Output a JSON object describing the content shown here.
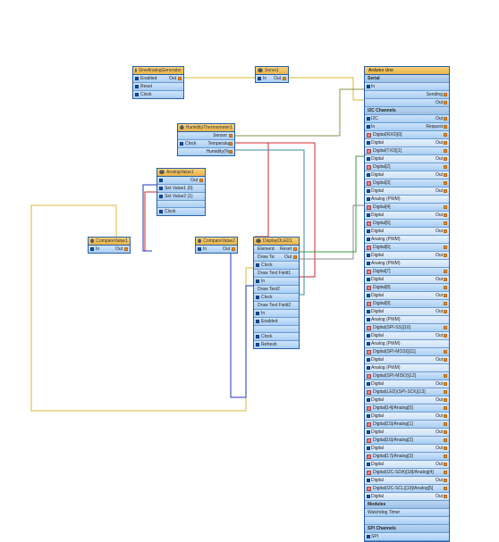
{
  "nodes": {
    "sineGen": {
      "title": "SineAnalogGenerator",
      "rows": [
        {
          "in": "Enabled",
          "out": "Out"
        },
        {
          "in": "Reset",
          "out": ""
        },
        {
          "in": "Clock",
          "out": ""
        }
      ]
    },
    "servo": {
      "title": "Servo1",
      "rows": [
        {
          "in": "In",
          "out": "Out"
        }
      ]
    },
    "thermo": {
      "title": "HumidityThermometer1",
      "rows": [
        {
          "in": "",
          "out": "Sensor"
        },
        {
          "in": "Clock",
          "out": "Temperature"
        },
        {
          "in": "",
          "out": "Humidity(%)"
        }
      ]
    },
    "analogVal": {
      "title": "AnalogValue1",
      "rows": [
        {
          "in": "",
          "out": "Out"
        },
        {
          "in": "Set Value1 (0)",
          "out": ""
        },
        {
          "in": "Set Value2 (1)",
          "out": ""
        },
        {
          "in": "",
          "out": ""
        },
        {
          "in": "Clock",
          "out": ""
        }
      ]
    },
    "compare1": {
      "title": "CompareValue1",
      "rows": [
        {
          "in": "In",
          "out": "Out"
        }
      ]
    },
    "compare2": {
      "title": "CompareValue2",
      "rows": [
        {
          "in": "In",
          "out": "Out"
        }
      ]
    },
    "display": {
      "title": "DisplayOLED1",
      "rows": [
        {
          "in": "Elements",
          "out": "Reset"
        },
        {
          "in": "Draw Text1",
          "out": "Out"
        },
        {
          "in": "Clock",
          "out": ""
        },
        {
          "in": "Draw Text Field1",
          "out": ""
        },
        {
          "in": "In",
          "out": ""
        },
        {
          "in": "Draw Text2",
          "out": ""
        },
        {
          "in": "Clock",
          "out": ""
        },
        {
          "in": "Draw Text Field2",
          "out": ""
        },
        {
          "in": "In",
          "out": ""
        },
        {
          "in": "Enabled",
          "out": ""
        },
        {
          "in": "",
          "out": ""
        },
        {
          "in": "Clock",
          "out": ""
        },
        {
          "in": "Refresh",
          "out": ""
        }
      ]
    }
  },
  "arduino": {
    "title": "Arduino Uno",
    "serial": {
      "label": "Serial",
      "items": [
        "In",
        "",
        "Sending",
        "Out"
      ]
    },
    "i2c": {
      "label": "I2C Channels",
      "items": [
        "I2C",
        "In",
        "Out",
        "Request"
      ]
    },
    "digital_label": "Digital",
    "out_label": "Out",
    "channels": [
      "Digital(RX0)[0]",
      "Digital(TX0)[1]",
      "Digital[2]",
      "Digital[3]",
      "Digital[4]",
      "Digital[5]",
      "Digital[6]",
      "Digital[7]",
      "Digital[8]",
      "Digital[9]",
      "Digital(SPI-SS)[10]",
      "Digital(SPI-MOSI)[11]",
      "Digital(SPI-MISO)[12]",
      "Digital(LED)(SPI-SCK)[13]",
      "Digital[14]/Analog[0]",
      "Digital[15]/Analog[1]",
      "Digital[16]/Analog[2]",
      "Digital[17]/Analog[3]",
      "Digital(I2C-SDA)[18]/Analog[4]",
      "Digital(I2C-SCL)[19]/Analog[5]"
    ],
    "analog_rows": [
      "Analog (PWM)",
      "Analog (PWM)",
      "Analog (PWM)",
      "Analog (PWM)",
      "Analog (PWM)",
      "Analog (PWM)"
    ],
    "bottom": [
      "Modules",
      "Watchdog Timer",
      "",
      "SPI Channels",
      "SPI"
    ]
  },
  "wire_colors": {
    "yellow": "#d4b83a",
    "red": "#cc2a2a",
    "blue": "#2030c0",
    "olive": "#8a914a",
    "teal": "#3a8a9a",
    "purple": "#7a4aa0",
    "green": "#3a9a4a",
    "gray": "#888"
  }
}
